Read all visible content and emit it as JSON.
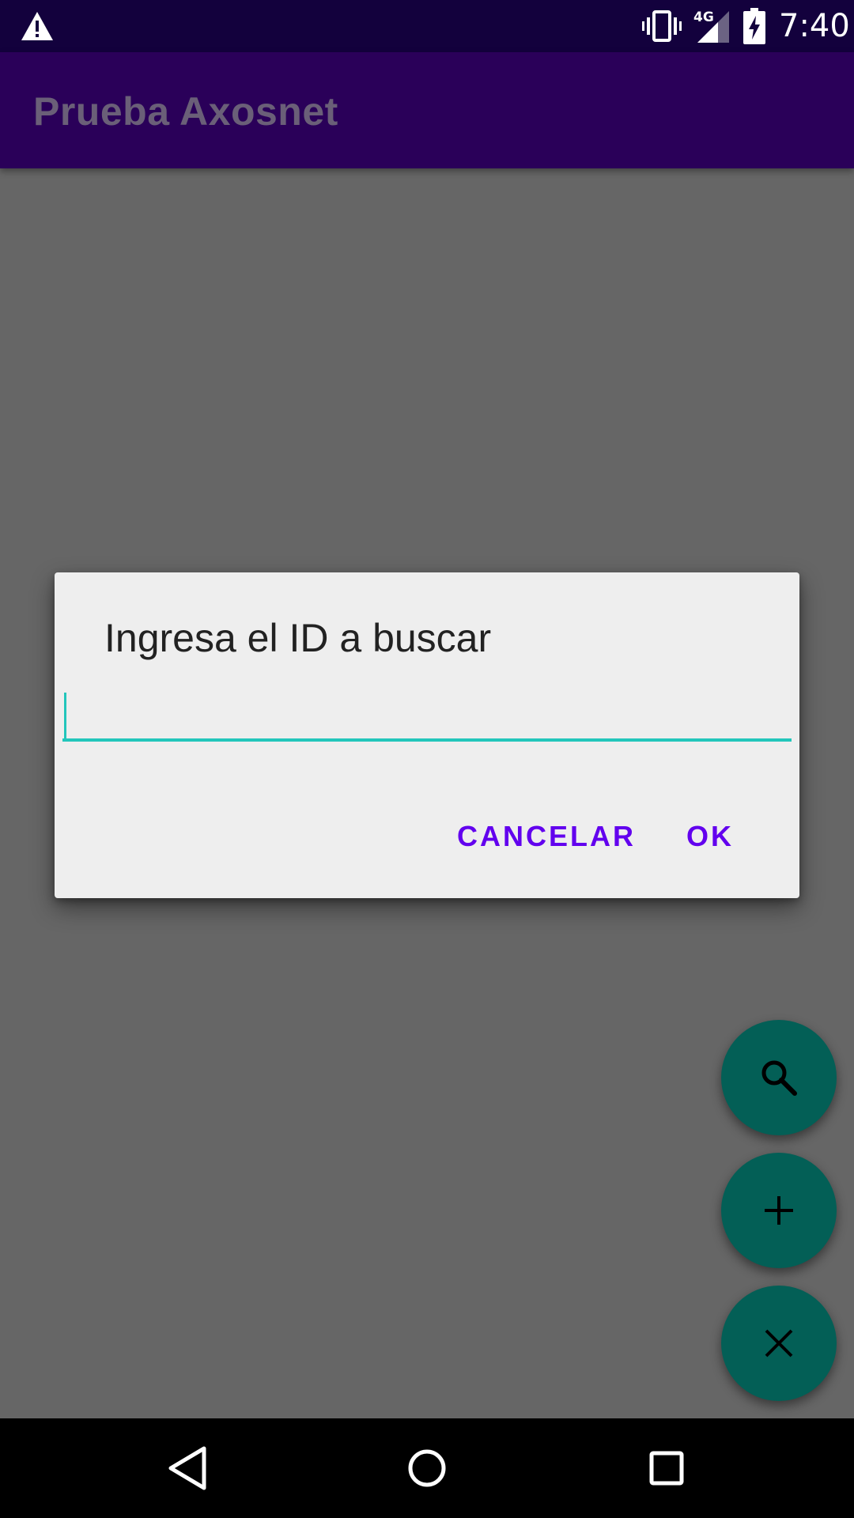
{
  "status_bar": {
    "time": "7:40",
    "network_label": "4G",
    "icons": [
      "warning-icon",
      "vibrate-icon",
      "signal-icon",
      "battery-charging-icon"
    ]
  },
  "app_bar": {
    "title": "Prueba Axosnet"
  },
  "dialog": {
    "title": "Ingresa el ID a buscar",
    "input_value": "",
    "cancel_label": "CANCELAR",
    "ok_label": "OK"
  },
  "fabs": [
    {
      "icon": "search-icon"
    },
    {
      "icon": "plus-icon"
    },
    {
      "icon": "close-icon"
    }
  ],
  "nav_bar": {
    "icons": [
      "back-icon",
      "home-icon",
      "recents-icon"
    ]
  },
  "colors": {
    "status_bar": "#13013d",
    "app_bar": "#2a0059",
    "scrim_background": "#666666",
    "dialog_background": "#eeeeee",
    "accent_input": "#22c6bb",
    "button_text": "#6200ee",
    "fab": "#035f56"
  }
}
